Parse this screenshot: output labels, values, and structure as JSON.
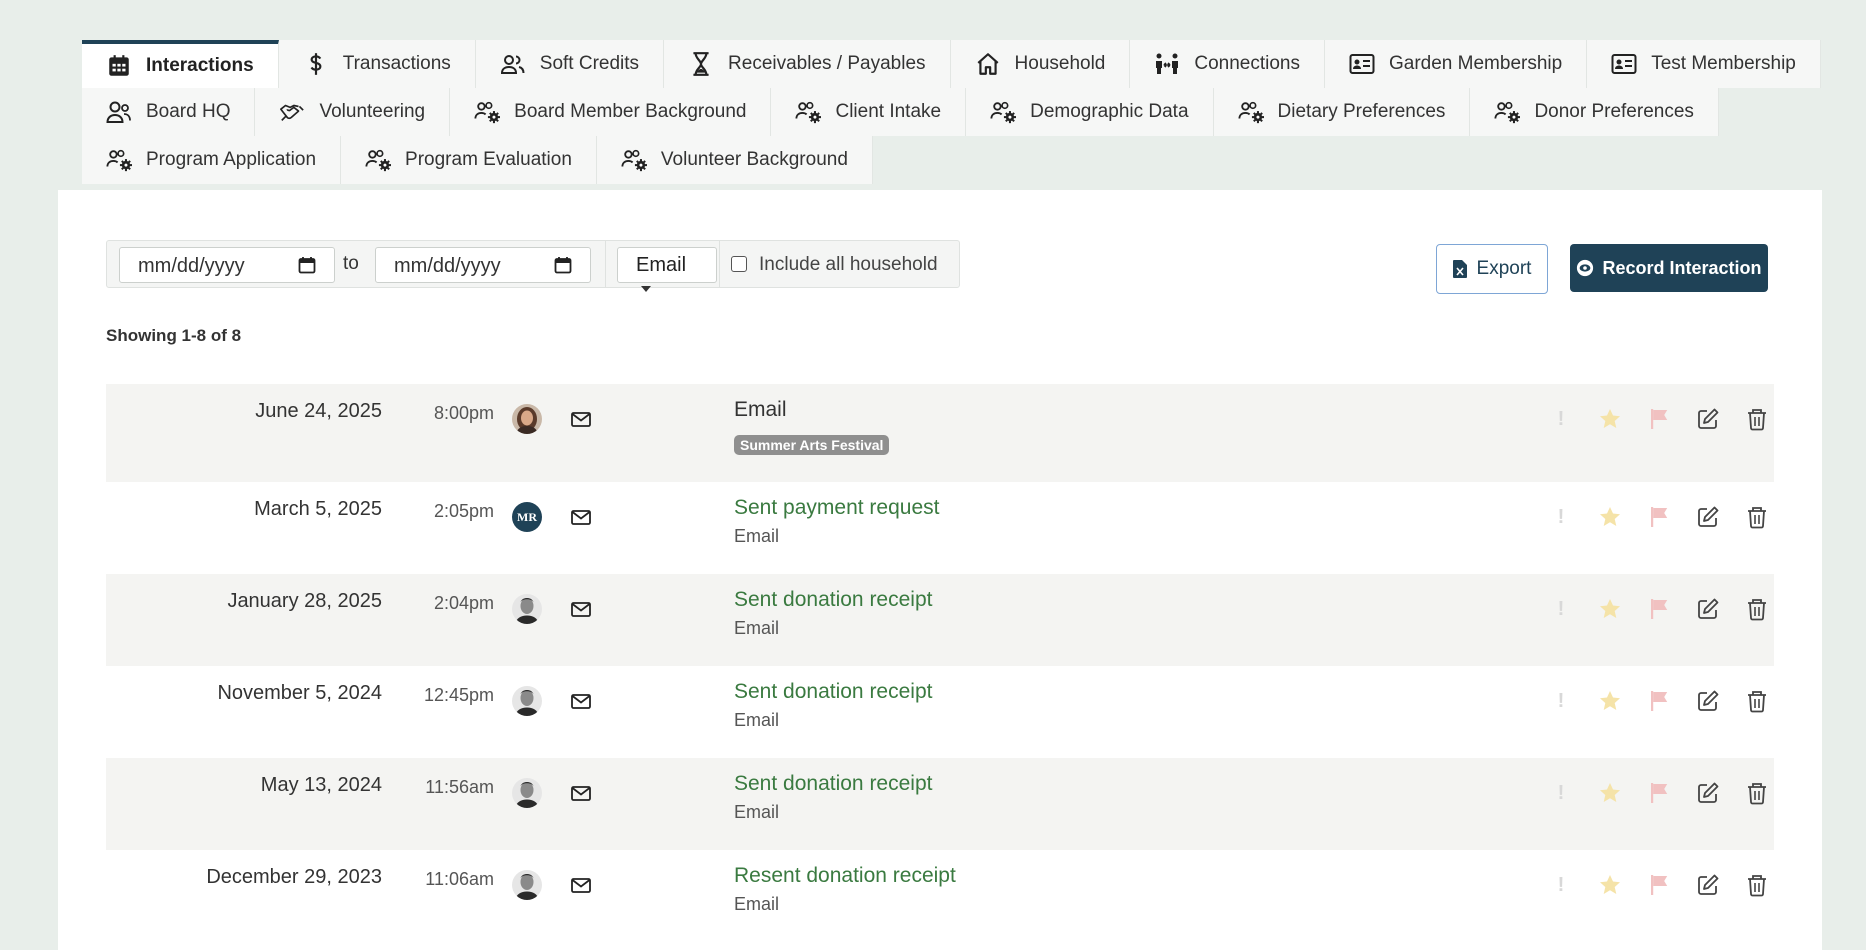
{
  "colors": {
    "accent": "#1f4257",
    "link": "#3a7a40",
    "star": "#f5e3a8",
    "flag": "#f1c1c1"
  },
  "tabs": {
    "row1": [
      {
        "label": "Interactions",
        "icon": "calendar-icon",
        "active": true
      },
      {
        "label": "Transactions",
        "icon": "dollar-icon"
      },
      {
        "label": "Soft Credits",
        "icon": "users-icon"
      },
      {
        "label": "Receivables / Payables",
        "icon": "hourglass-icon"
      },
      {
        "label": "Household",
        "icon": "home-icon"
      },
      {
        "label": "Connections",
        "icon": "connections-icon"
      },
      {
        "label": "Garden Membership",
        "icon": "id-card-icon"
      },
      {
        "label": "Test Membership",
        "icon": "id-card-icon"
      }
    ],
    "row2": [
      {
        "label": "Board HQ",
        "icon": "user-group-icon"
      },
      {
        "label": "Volunteering",
        "icon": "handshake-icon"
      },
      {
        "label": "Board Member Background",
        "icon": "users-cog-icon"
      },
      {
        "label": "Client Intake",
        "icon": "users-cog-icon"
      },
      {
        "label": "Demographic Data",
        "icon": "users-cog-icon"
      },
      {
        "label": "Dietary Preferences",
        "icon": "users-cog-icon"
      },
      {
        "label": "Donor Preferences",
        "icon": "users-cog-icon"
      }
    ],
    "row3": [
      {
        "label": "Program Application",
        "icon": "users-cog-icon"
      },
      {
        "label": "Program Evaluation",
        "icon": "users-cog-icon"
      },
      {
        "label": "Volunteer Background",
        "icon": "users-cog-icon"
      }
    ]
  },
  "filters": {
    "date_from_placeholder": "mm/dd/yyyy",
    "to_label": "to",
    "date_to_placeholder": "mm/dd/yyyy",
    "type_selected": "Email",
    "household_label": "Include all household",
    "household_checked": false
  },
  "actions": {
    "export_label": "Export",
    "record_label": "Record Interaction"
  },
  "showing": "Showing 1-8 of 8",
  "interactions": [
    {
      "date": "June 24, 2025",
      "time": "8:00pm",
      "avatar": "photo-woman",
      "title": "Email",
      "title_style": "plain",
      "tag": "Summer Arts Festival"
    },
    {
      "date": "March 5, 2025",
      "time": "2:05pm",
      "avatar": "initials",
      "initials": "MR",
      "title": "Sent payment request",
      "title_style": "link",
      "sub": "Email"
    },
    {
      "date": "January 28, 2025",
      "time": "2:04pm",
      "avatar": "photo-man",
      "title": "Sent donation receipt",
      "title_style": "link",
      "sub": "Email"
    },
    {
      "date": "November 5, 2024",
      "time": "12:45pm",
      "avatar": "photo-man",
      "title": "Sent donation receipt",
      "title_style": "link",
      "sub": "Email"
    },
    {
      "date": "May 13, 2024",
      "time": "11:56am",
      "avatar": "photo-man",
      "title": "Sent donation receipt",
      "title_style": "link",
      "sub": "Email"
    },
    {
      "date": "December 29, 2023",
      "time": "11:06am",
      "avatar": "photo-man",
      "title": "Resent donation receipt",
      "title_style": "link",
      "sub": "Email"
    }
  ]
}
